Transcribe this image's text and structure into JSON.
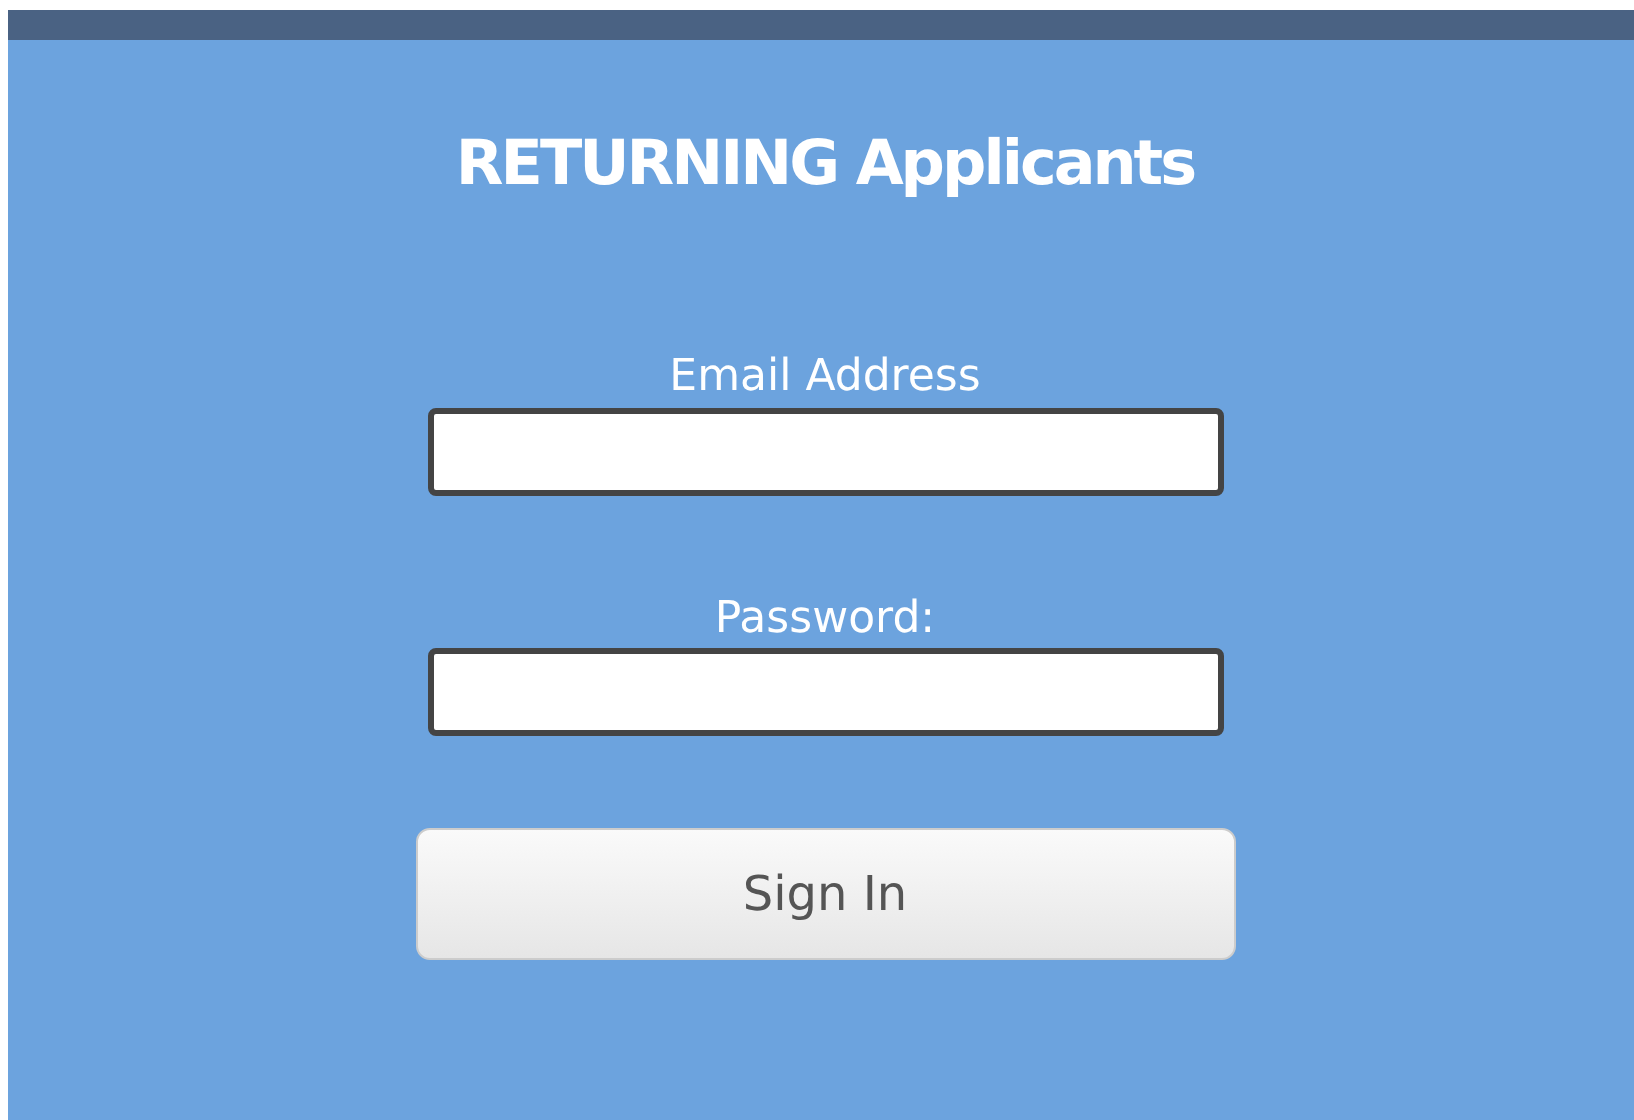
{
  "heading": "RETURNING Applicants",
  "fields": [
    {
      "label": "Email Address"
    },
    {
      "label": "Password:"
    }
  ],
  "button": "Sign In"
}
